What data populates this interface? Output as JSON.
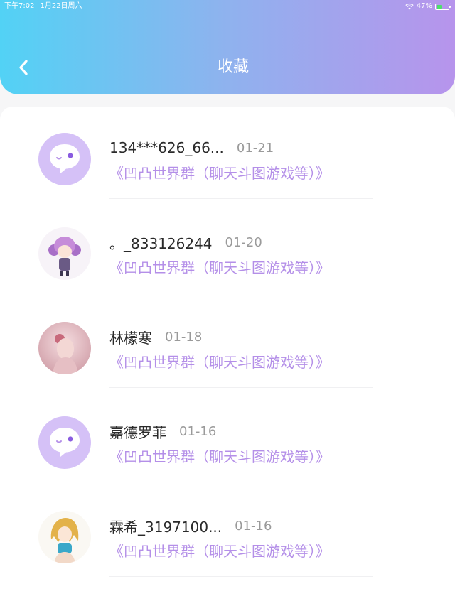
{
  "status_bar": {
    "time": "下午7:02",
    "date": "1月22日周六",
    "battery": "47%",
    "battery_level": 0.47
  },
  "header": {
    "title": "收藏",
    "back_icon": "chevron-left-icon"
  },
  "colors": {
    "header_gradient_start": "#52d2f5",
    "header_gradient_end": "#b794ec",
    "group_text": "#b48fe8",
    "avatar_default_bg": "#d5c1f7"
  },
  "favorites": [
    {
      "name": "134***626_66...",
      "date": "01-21",
      "group": "《凹凸世界群（聊天斗图游戏等）》",
      "avatar": "default-chat-avatar"
    },
    {
      "name": "。_833126244",
      "date": "01-20",
      "group": "《凹凸世界群（聊天斗图游戏等）》",
      "avatar": "anime-girl-purple-avatar"
    },
    {
      "name": "林檬寒",
      "date": "01-18",
      "group": "《凹凸世界群（聊天斗图游戏等）》",
      "avatar": "pink-girl-avatar"
    },
    {
      "name": "嘉德罗菲",
      "date": "01-16",
      "group": "《凹凸世界群（聊天斗图游戏等）》",
      "avatar": "default-chat-avatar"
    },
    {
      "name": "霖希_3197100...",
      "date": "01-16",
      "group": "《凹凸世界群（聊天斗图游戏等）》",
      "avatar": "anime-blonde-avatar"
    }
  ]
}
